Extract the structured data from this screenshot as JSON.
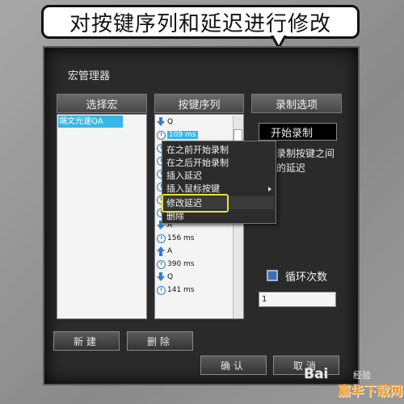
{
  "callout": {
    "text": "对按键序列和延迟进行修改"
  },
  "window": {
    "title": "宏管理器"
  },
  "panels": {
    "select_macro": {
      "header": "选择宏",
      "items": [
        "端文光速QA"
      ]
    },
    "key_sequence": {
      "header": "按键序列",
      "rows": [
        {
          "icon": "arrow-down-icon",
          "text": "Q"
        },
        {
          "icon": "clock-icon",
          "text": "109 ms",
          "selected": true
        },
        {
          "icon": "clock-icon",
          "text": ""
        },
        {
          "icon": "clock-icon",
          "text": ""
        },
        {
          "icon": "clock-icon",
          "text": ""
        },
        {
          "icon": "clock-icon",
          "text": ""
        },
        {
          "icon": "clock-icon",
          "text": ""
        },
        {
          "icon": "clock-icon",
          "text": ""
        },
        {
          "icon": "arrow-down-icon",
          "text": "A"
        },
        {
          "icon": "clock-icon",
          "text": "156 ms"
        },
        {
          "icon": "arrow-up-icon",
          "text": "A"
        },
        {
          "icon": "clock-icon",
          "text": "390 ms"
        },
        {
          "icon": "arrow-down-icon",
          "text": "Q"
        },
        {
          "icon": "clock-icon",
          "text": "141 ms"
        }
      ]
    },
    "record_options": {
      "header": "录制选项",
      "start_button": "开始录制",
      "note": "录制按键之间的延迟",
      "loop_label": "循环次数",
      "loop_value": "1"
    }
  },
  "context_menu": {
    "items": [
      "在之前开始录制",
      "在之后开始录制",
      "插入延迟",
      "插入鼠标按键",
      "修改延迟",
      "删除"
    ],
    "highlighted": "修改延迟"
  },
  "buttons": {
    "new": "新建",
    "delete": "删除",
    "ok": "确认",
    "cancel": "取消"
  },
  "watermark": {
    "logo": "Bai",
    "logo_suffix": "经验",
    "site": "嘉华下载网"
  },
  "colors": {
    "selection": "#37b7e6",
    "focus_box": "#f0e030",
    "icon": "#2f7fd0"
  }
}
